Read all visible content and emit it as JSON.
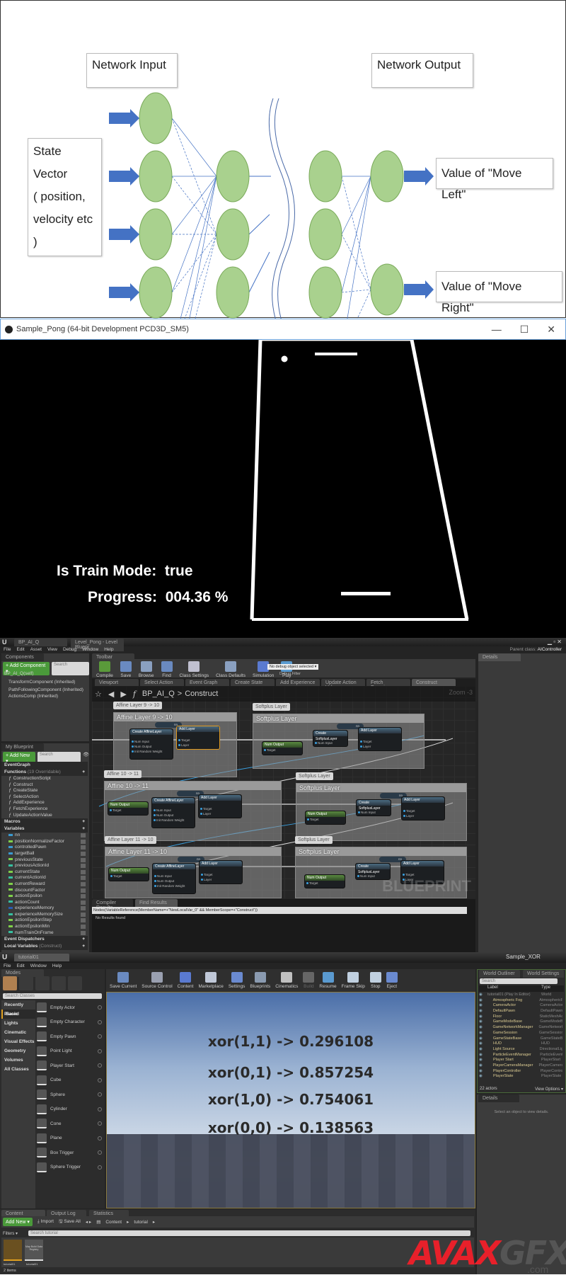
{
  "diagram": {
    "network_input": "Network Input",
    "network_output": "Network Output",
    "state_vector": [
      "State Vector",
      "( position,",
      "velocity etc )"
    ],
    "out_left": "Value of \"Move Left\"",
    "out_right": "Value of \"Move Right\"",
    "node_color": "#a9d18e",
    "arrow_color": "#4472c4"
  },
  "pong": {
    "window_title": "Sample_Pong (64-bit Development PCD3D_SM5)",
    "controls": [
      "—",
      "☐",
      "✕"
    ],
    "train_label": "Is Train Mode:",
    "train_value": "true",
    "progress_label": "Progress:",
    "progress_value": "004.36 %"
  },
  "blueprint": {
    "tabs": [
      "BP_AI_Q",
      "Level_Pong - Level Bluepr"
    ],
    "menu": [
      "File",
      "Edit",
      "Asset",
      "View",
      "Debug",
      "Window",
      "Help"
    ],
    "parent_class_label": "Parent class:",
    "parent_class": "AIController",
    "components": {
      "tab": "Components",
      "add": "+ Add Component ▾",
      "search": "Search",
      "items": [
        "BP_AI_Q(self)",
        "TransformComponent (Inherited)",
        "PathFollowingComponent (Inherited)",
        "ActionsComp (Inherited)"
      ]
    },
    "toolbar_tab": "Toolbar",
    "toolbar": [
      "Compile",
      "Save",
      "Browse",
      "Find",
      "Class Settings",
      "Class Defaults",
      "Simulation",
      "Play"
    ],
    "debug_select": "No debug object selected ▾",
    "debug_filter": "Debug Filter",
    "graph_tabs": [
      "Viewport",
      "Select Action",
      "Event Graph",
      "Create State",
      "Add Experience",
      "Update Action Valu",
      "Fetch Experience",
      "Construct"
    ],
    "breadcrumb": {
      "root": "BP_AI_Q",
      "sep": ">",
      "current": "Construct"
    },
    "zoom": "Zoom -3",
    "watermark": "BLUEPRINT",
    "details_tab": "Details",
    "my_blueprint": {
      "tab": "My Blueprint",
      "add": "+ Add New ▾",
      "search": "Search",
      "event_graph": "EventGraph",
      "functions_header": "Functions",
      "functions_note": "(19 Overridable)",
      "functions": [
        "ConstructionScript",
        "Construct",
        "CreateState",
        "SelectAction",
        "AddExperience",
        "FetchExperience",
        "UpdateActionValue"
      ],
      "macros": "Macros",
      "variables_header": "Variables",
      "variables": [
        "nn",
        "positionNormalizeFactor",
        "controlledPawn",
        "targetBall",
        "previousState",
        "previousActionId",
        "currentState",
        "currentActionId",
        "currentReward",
        "discountFactor",
        "actionEpsilon",
        "actionCount",
        "experienceMemory",
        "experienceMemorySize",
        "actionEpsilonStep",
        "actionEpsilonMin",
        "numTrainOnFrame"
      ],
      "event_dispatchers": "Event Dispatchers",
      "local_variables": "Local Variables",
      "local_note": "(Construct)"
    },
    "comments": [
      {
        "bubble": "Affine Layer 9 -> 10",
        "title": "Affine Layer 9 -> 10"
      },
      {
        "bubble": "Softplus Layer",
        "title": "Softplus Layer"
      },
      {
        "bubble": "Affine 10 -> 11",
        "title": "Affine 10 -> 11"
      },
      {
        "bubble": "Softplus Layer",
        "title": "Softplus Layer"
      },
      {
        "bubble": "Affine Layer 11 -> 10",
        "title": "Affine Layer 11 -> 10"
      },
      {
        "bubble": "Softplus Layer",
        "title": "Softplus Layer"
      }
    ],
    "nodes": {
      "num_output": "Num Output",
      "create_affine": "Create AffineLayer",
      "create_softplus": "Create SoftplusLayer",
      "add_layer": "Add Layer",
      "target": "Target",
      "layer": "Layer",
      "num_input": "Num Input",
      "num_output_pin": "Num Output",
      "return_value": "Return Value",
      "init_random": "Init Random Weight",
      "nn": "nn",
      "num_in_9": "9",
      "num_out_10": "10",
      "num_out_11": "11"
    },
    "results_tabs": [
      "Compiler Results",
      "Find Results"
    ],
    "find_query": "Nodes(VariableReference(MemberName=+\"NewLocalVar_0\" && MemberScope=+\"Construct\"))",
    "no_results": "No Results found"
  },
  "editor": {
    "tab": "tutorial01",
    "title": "Sample_XOR",
    "menu": [
      "File",
      "Edit",
      "Window",
      "Help"
    ],
    "modes_tab": "Modes",
    "search_classes": "Search Classes",
    "categories": [
      "Recently Placed",
      "Basic",
      "Lights",
      "Cinematic",
      "Visual Effects",
      "Geometry",
      "Volumes",
      "All Classes"
    ],
    "items": [
      "Empty Actor",
      "Empty Character",
      "Empty Pawn",
      "Point Light",
      "Player Start",
      "Cube",
      "Sphere",
      "Cylinder",
      "Cone",
      "Plane",
      "Box Trigger",
      "Sphere Trigger"
    ],
    "toolbar": [
      "Save Current",
      "Source Control",
      "Content",
      "Marketplace",
      "Settings",
      "Blueprints",
      "Cinematics",
      "Build",
      "Resume",
      "Frame Skip",
      "Stop",
      "Eject"
    ],
    "xor": [
      "xor(1,1) -> 0.296108",
      "xor(0,1) -> 0.857254",
      "xor(1,0) -> 0.754061",
      "xor(0,0) -> 0.138563"
    ],
    "outliner": {
      "tab": "World Outliner",
      "tab2": "World Settings",
      "search": "Search",
      "col_label": "Label",
      "col_type": "Type",
      "rows": [
        [
          "tutorial01 (Play In Editor)",
          "World"
        ],
        [
          "Atmospheric Fog",
          "AtmosphericF"
        ],
        [
          "CameraActor",
          "CameraActor"
        ],
        [
          "DefaultPawn",
          "DefaultPawn"
        ],
        [
          "Floor",
          "StaticMeshAc"
        ],
        [
          "GameModeBase",
          "GameModeB"
        ],
        [
          "GameNetworkManager",
          "GameNetwork"
        ],
        [
          "GameSession",
          "GameSession"
        ],
        [
          "GameStateBase",
          "GameStateB"
        ],
        [
          "HUD",
          "HUD"
        ],
        [
          "Light Source",
          "DirectionalLig"
        ],
        [
          "ParticleEventManager",
          "ParticleEvent"
        ],
        [
          "Player Start",
          "PlayerStart"
        ],
        [
          "PlayerCameraManager",
          "PlayerCamera"
        ],
        [
          "PlayerController",
          "PlayerContro"
        ],
        [
          "PlayerState",
          "PlayerState"
        ]
      ],
      "count": "22 actors",
      "view_options": "View Options ▾"
    },
    "details_tab": "Details",
    "details_empty": "Select an object to view details.",
    "bottom_tabs": [
      "Content Browser",
      "Output Log",
      "Statistics"
    ],
    "add_new": "Add New ▾",
    "import": "Import",
    "save_all": "Save All",
    "path": [
      "Content",
      "tutorial"
    ],
    "filters": "Filters ▾",
    "search_tutorial": "Search tutorial",
    "assets": [
      "tutorial01",
      "tutorial01"
    ],
    "asset_thumb_text": "Map Build Data Registry",
    "items_count": "2 items"
  },
  "watermark": {
    "brand": "AVAXGFX",
    "suffix": ".com"
  }
}
